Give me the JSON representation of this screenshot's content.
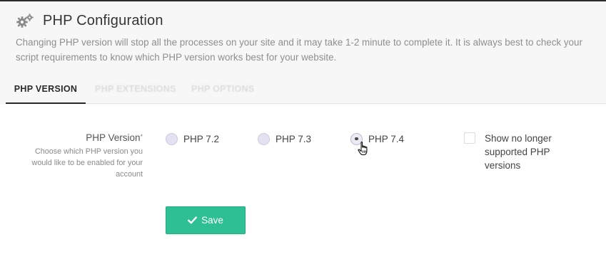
{
  "header": {
    "title": "PHP Configuration",
    "icon": "gears-icon",
    "description": "Changing PHP version will stop all the processes on your site and it may take 1-2 minute to complete it. It is always best to check your script requirements to know which PHP version works best for your website."
  },
  "tabs": [
    {
      "label": "PHP VERSION",
      "active": true
    },
    {
      "label": "PHP EXTENSIONS",
      "active": false
    },
    {
      "label": "PHP OPTIONS",
      "active": false
    }
  ],
  "php_version_field": {
    "label": "PHP Version",
    "required_mark": "*",
    "help": "Choose which PHP version you would like to be enabled for your account",
    "options": [
      {
        "label": "PHP 7.2",
        "selected": false
      },
      {
        "label": "PHP 7.3",
        "selected": false
      },
      {
        "label": "PHP 7.4",
        "selected": true
      }
    ]
  },
  "unsupported_toggle": {
    "label": "Show no longer supported PHP versions",
    "checked": false
  },
  "save_button": {
    "label": "Save",
    "icon": "check-icon"
  },
  "colors": {
    "accent": "#2ebf95",
    "header_bg": "#f7f7f7",
    "radio_fill": "#e4e1f0"
  }
}
